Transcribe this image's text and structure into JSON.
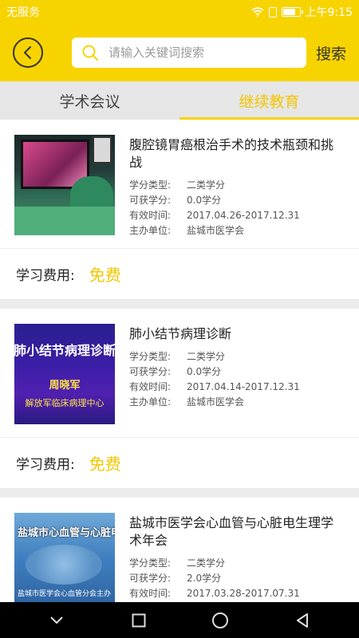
{
  "status_bar": {
    "carrier": "无服务",
    "time": "上午9:15",
    "icons": [
      "wifi-icon",
      "sim-icon",
      "battery-icon"
    ]
  },
  "header": {
    "back_icon": "chevron-left-icon",
    "search_placeholder": "请输入关键词搜索",
    "search_icon": "search-icon",
    "search_button": "搜索"
  },
  "tabs": [
    {
      "label": "学术会议",
      "active": false
    },
    {
      "label": "继续教育",
      "active": true
    }
  ],
  "courses": [
    {
      "title": "腹腔镜胃癌根治手术的技术瓶颈和挑战",
      "meta": [
        {
          "key": "学分类型:",
          "value": "二类学分"
        },
        {
          "key": "可获学分:",
          "value": "0.0学分"
        },
        {
          "key": "有效时间:",
          "value": "2017.04.26-2017.12.31"
        },
        {
          "key": "主办单位:",
          "value": "盐城市医学会"
        }
      ],
      "fee_label": "学习费用:",
      "fee_value": "免费"
    },
    {
      "title": "肺小结节病理诊断",
      "thumb_text": {
        "title": "肺小结节病理诊断",
        "speaker": "周晓军",
        "org": "解放军临床病理中心"
      },
      "meta": [
        {
          "key": "学分类型:",
          "value": "二类学分"
        },
        {
          "key": "可获学分:",
          "value": "0.0学分"
        },
        {
          "key": "有效时间:",
          "value": "2017.04.14-2017.12.31"
        },
        {
          "key": "主办单位:",
          "value": "盐城市医学会"
        }
      ],
      "fee_label": "学习费用:",
      "fee_value": "免费"
    },
    {
      "title": "盐城市医学会心血管与心脏电生理学术年会",
      "thumb_text": {
        "title": "盐城市心血管与心脏电生",
        "subtitle": "盐城市医学会心血管分会主办"
      },
      "meta": [
        {
          "key": "学分类型:",
          "value": "二类学分"
        },
        {
          "key": "可获学分:",
          "value": "2.0学分"
        },
        {
          "key": "有效时间:",
          "value": "2017.03.28-2017.07.31"
        }
      ]
    }
  ],
  "nav_bar": {
    "icons": [
      "nav-collapse-icon",
      "recents-icon",
      "home-icon",
      "back-triangle-icon"
    ]
  },
  "colors": {
    "accent": "#f7d300",
    "accent_text": "#f2c600"
  }
}
